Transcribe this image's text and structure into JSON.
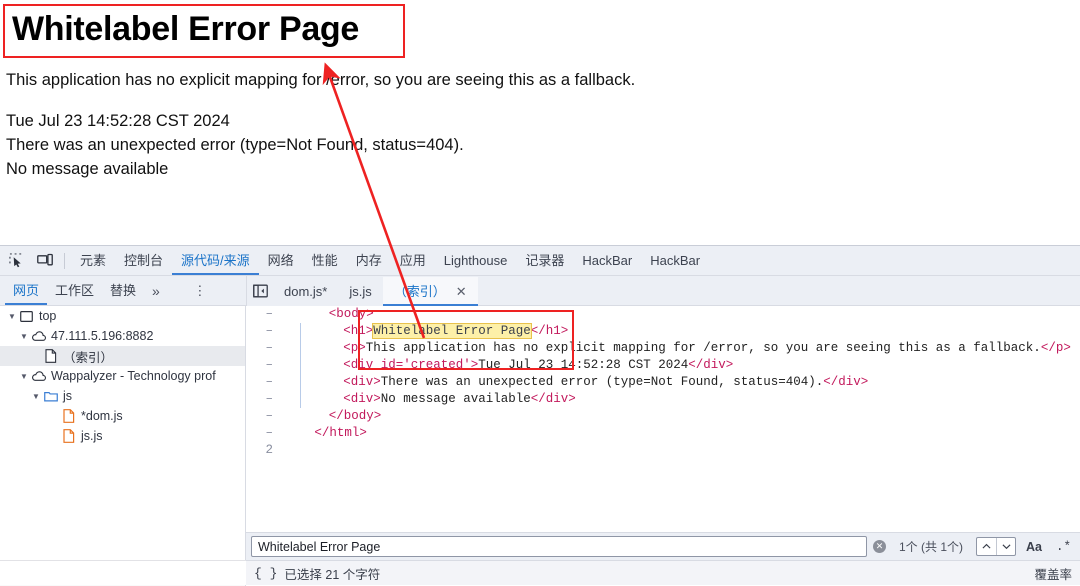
{
  "page": {
    "title": "Whitelabel Error Page",
    "subtitle": "This application has no explicit mapping for /error, so you are seeing this as a fallback.",
    "timestamp": "Tue Jul 23 14:52:28 CST 2024",
    "error_line": "There was an unexpected error (type=Not Found, status=404).",
    "message_line": "No message available"
  },
  "annotation": {
    "color": "#ee2222"
  },
  "devtools": {
    "icons": {
      "inspect": "inspect-element-icon",
      "device": "device-toolbar-icon"
    },
    "tabs": [
      {
        "label": "元素",
        "active": false
      },
      {
        "label": "控制台",
        "active": false
      },
      {
        "label": "源代码/来源",
        "active": true
      },
      {
        "label": "网络",
        "active": false
      },
      {
        "label": "性能",
        "active": false
      },
      {
        "label": "内存",
        "active": false
      },
      {
        "label": "应用",
        "active": false
      },
      {
        "label": "Lighthouse",
        "active": false
      },
      {
        "label": "记录器",
        "active": false
      },
      {
        "label": "HackBar",
        "active": false
      },
      {
        "label": "HackBar",
        "active": false
      }
    ],
    "subtabs": [
      {
        "label": "网页",
        "active": true
      },
      {
        "label": "工作区",
        "active": false
      },
      {
        "label": "替换",
        "active": false
      }
    ],
    "subtabs_more": "»",
    "kebab": "⋮",
    "editor_tabs": [
      {
        "label": "dom.js*",
        "active": false,
        "closable": false
      },
      {
        "label": "js.js",
        "active": false,
        "closable": false
      },
      {
        "label": "（索引）",
        "active": true,
        "closable": true
      }
    ],
    "close_glyph": "✕",
    "tree": [
      {
        "depth": 0,
        "twisty": "▼",
        "icon": "frame-icon",
        "label": "top",
        "selected": false
      },
      {
        "depth": 1,
        "twisty": "▼",
        "icon": "cloud-icon",
        "label": "47.111.5.196:8882",
        "selected": false
      },
      {
        "depth": 2,
        "twisty": "",
        "icon": "document-icon",
        "label": "（索引）",
        "selected": true
      },
      {
        "depth": 1,
        "twisty": "▼",
        "icon": "cloud-icon",
        "label": "Wappalyzer - Technology prof",
        "selected": false
      },
      {
        "depth": 2,
        "twisty": "▼",
        "icon": "folder-icon",
        "label": "js",
        "selected": false
      },
      {
        "depth": 3,
        "twisty": "",
        "icon": "js-file-icon",
        "label": "*dom.js",
        "selected": false
      },
      {
        "depth": 3,
        "twisty": "",
        "icon": "js-file-icon",
        "label": "js.js",
        "selected": false
      }
    ],
    "code_lines": [
      {
        "gutter": "–",
        "indent": 4,
        "segments": [
          {
            "t": "tag",
            "v": "<body>"
          }
        ]
      },
      {
        "gutter": "–",
        "indent": 6,
        "segments": [
          {
            "t": "tag",
            "v": "<h1>"
          },
          {
            "t": "hl",
            "v": "Whitelabel Error Page"
          },
          {
            "t": "tag",
            "v": "</h1>"
          }
        ]
      },
      {
        "gutter": "–",
        "indent": 6,
        "segments": [
          {
            "t": "tag",
            "v": "<p>"
          },
          {
            "t": "text",
            "v": "This application has no explicit mapping for /error, so you are seeing this as a fallback."
          },
          {
            "t": "tag",
            "v": "</p>"
          }
        ]
      },
      {
        "gutter": "–",
        "indent": 6,
        "segments": [
          {
            "t": "tag",
            "v": "<div "
          },
          {
            "t": "attr",
            "v": "id="
          },
          {
            "t": "aval",
            "v": "'created'"
          },
          {
            "t": "tag",
            "v": ">"
          },
          {
            "t": "text",
            "v": "Tue Jul 23 14:52:28 CST 2024"
          },
          {
            "t": "tag",
            "v": "</div>"
          }
        ]
      },
      {
        "gutter": "–",
        "indent": 6,
        "segments": [
          {
            "t": "tag",
            "v": "<div>"
          },
          {
            "t": "text",
            "v": "There was an unexpected error (type=Not Found, status=404)."
          },
          {
            "t": "tag",
            "v": "</div>"
          }
        ]
      },
      {
        "gutter": "–",
        "indent": 6,
        "segments": [
          {
            "t": "tag",
            "v": "<div>"
          },
          {
            "t": "text",
            "v": "No message available"
          },
          {
            "t": "tag",
            "v": "</div>"
          }
        ]
      },
      {
        "gutter": "–",
        "indent": 4,
        "segments": [
          {
            "t": "tag",
            "v": "</body>"
          }
        ]
      },
      {
        "gutter": "–",
        "indent": 2,
        "segments": [
          {
            "t": "tag",
            "v": "</html>"
          }
        ]
      },
      {
        "gutter": "2",
        "indent": 0,
        "segments": []
      }
    ],
    "search": {
      "value": "Whitelabel Error Page",
      "placeholder": "",
      "clear_glyph": "✕",
      "match_count": "1个 (共 1个)",
      "prev_glyph": "⌃",
      "next_glyph": "⌄",
      "match_case_label": "Aa",
      "regex_label": ".*"
    },
    "status": {
      "format_icon": "{ }",
      "selection_text": "已选择 21 个字符",
      "coverage_label": "覆盖率"
    }
  }
}
